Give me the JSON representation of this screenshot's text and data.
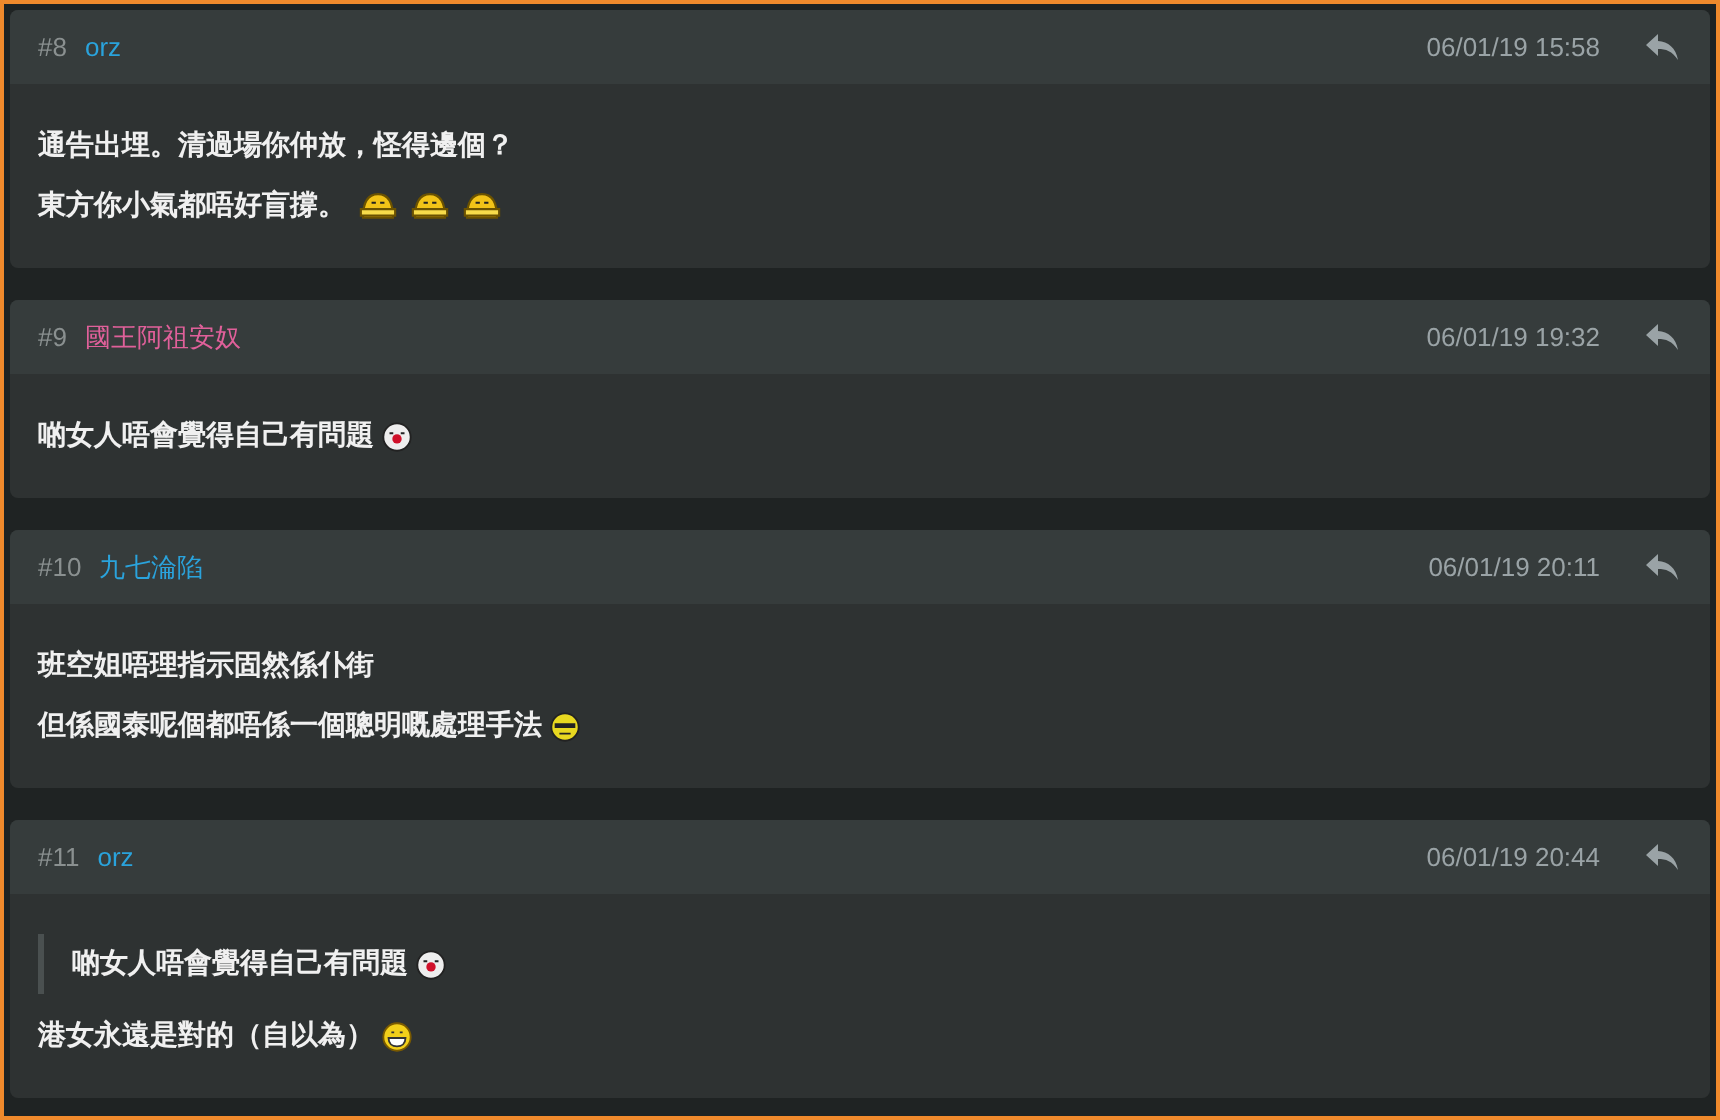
{
  "posts": [
    {
      "number": "#8",
      "user": "orz",
      "color": "#2aa3dc",
      "time": "06/01/19 15:58",
      "lines": [
        {
          "text": "通告出埋。清過場你仲放，怪得邊個？"
        },
        {
          "text": "東方你小氣都唔好盲撐。",
          "emoji": [
            {
              "kind": "shy"
            },
            {
              "kind": "shy"
            },
            {
              "kind": "shy"
            }
          ]
        }
      ]
    },
    {
      "number": "#9",
      "user": "國王阿祖安奴",
      "color": "#e0609a",
      "time": "06/01/19 19:32",
      "lines": [
        {
          "text": "啲女人唔會覺得自己有問題",
          "emoji": [
            {
              "kind": "tongue"
            }
          ]
        }
      ]
    },
    {
      "number": "#10",
      "user": "九七淪陷",
      "color": "#2aa3dc",
      "time": "06/01/19 20:11",
      "lines": [
        {
          "text": "班空姐唔理指示固然係仆街"
        },
        {
          "text": "但係國泰呢個都唔係一個聰明嘅處理手法",
          "emoji": [
            {
              "kind": "cool"
            }
          ]
        }
      ]
    },
    {
      "number": "#11",
      "user": "orz",
      "color": "#2aa3dc",
      "time": "06/01/19 20:44",
      "quote": {
        "text": "啲女人唔會覺得自己有問題",
        "emoji": [
          {
            "kind": "tongue"
          }
        ]
      },
      "lines": [
        {
          "text": "港女永遠是對的（自以為）",
          "emoji": [
            {
              "kind": "grin"
            }
          ]
        }
      ]
    }
  ]
}
